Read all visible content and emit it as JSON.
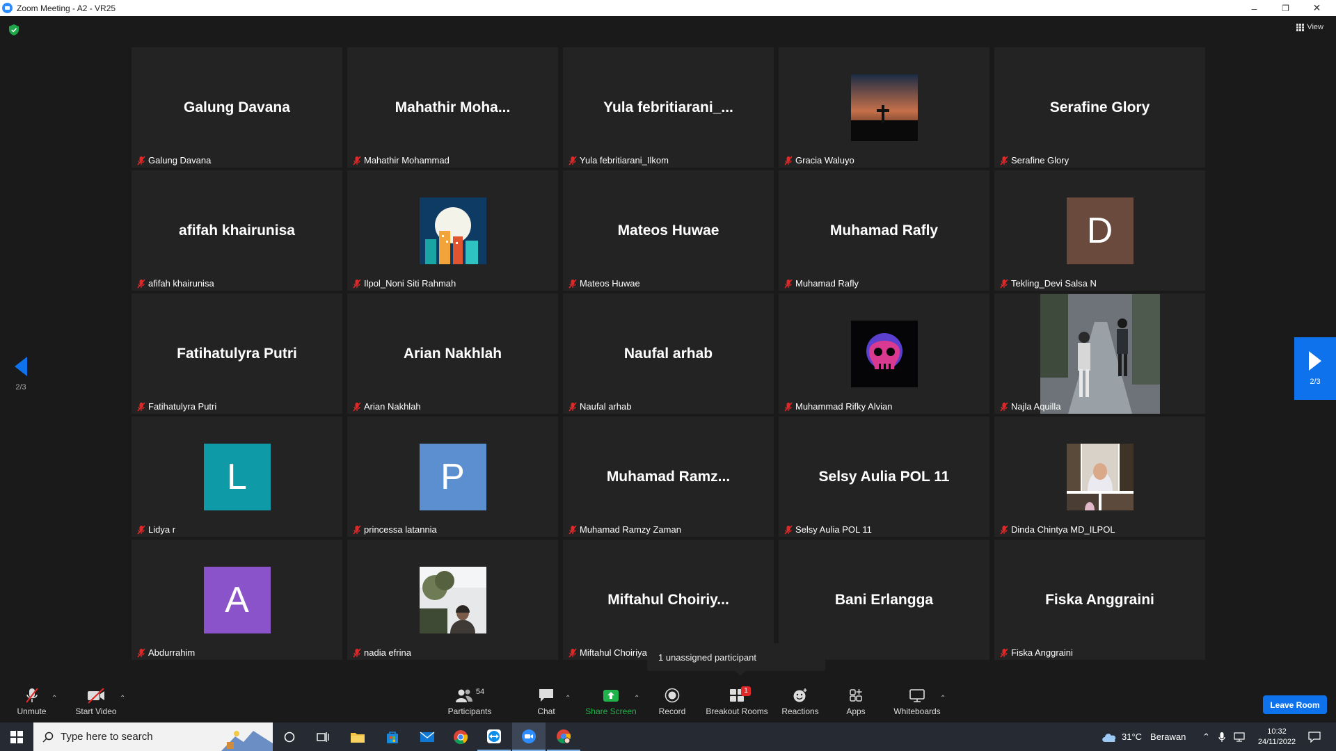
{
  "window": {
    "title": "Zoom Meeting - A2 - VR25",
    "minimize": "–",
    "restore": "❐",
    "close": "✕"
  },
  "view_button": {
    "label": "View"
  },
  "pagination": {
    "left": "2/3",
    "right": "2/3"
  },
  "participants": [
    {
      "display": "Galung Davana",
      "label": "Galung Davana",
      "kind": "name"
    },
    {
      "display": "Mahathir  Moha...",
      "label": "Mahathir Mohammad",
      "kind": "name"
    },
    {
      "display": "Yula  febritiarani_...",
      "label": "Yula febritiarani_Ilkom",
      "kind": "name"
    },
    {
      "display": "",
      "label": "Gracia Waluyo",
      "kind": "photo",
      "photo": "sunset-cross"
    },
    {
      "display": "Serafine Glory",
      "label": "Serafine Glory",
      "kind": "name"
    },
    {
      "display": "afifah khairunisa",
      "label": "afifah khairunisa",
      "kind": "name"
    },
    {
      "display": "",
      "label": "Ilpol_Noni Siti Rahmah",
      "kind": "photo",
      "photo": "moon-city"
    },
    {
      "display": "Mateos Huwae",
      "label": "Mateos Huwae",
      "kind": "name"
    },
    {
      "display": "Muhamad Rafly",
      "label": "Muhamad Rafly",
      "kind": "name"
    },
    {
      "display": "D",
      "label": "Tekling_Devi Salsa N",
      "kind": "letter",
      "color": "#6a4a3c"
    },
    {
      "display": "Fatihatulyra Putri",
      "label": "Fatihatulyra Putri",
      "kind": "name"
    },
    {
      "display": "Arian Nakhlah",
      "label": "Arian Nakhlah",
      "kind": "name"
    },
    {
      "display": "Naufal arhab",
      "label": "Naufal arhab",
      "kind": "name"
    },
    {
      "display": "",
      "label": "Muhammad Rifky Alvian",
      "kind": "photo",
      "photo": "neon-skull"
    },
    {
      "display": "",
      "label": "Najla Aquilla",
      "kind": "photo",
      "photo": "rainy-street"
    },
    {
      "display": "L",
      "label": "Lidya r",
      "kind": "letter",
      "color": "#0e9aa7"
    },
    {
      "display": "P",
      "label": "princessa latannia",
      "kind": "letter",
      "color": "#5b8fcf"
    },
    {
      "display": "Muhamad  Ramz...",
      "label": "Muhamad Ramzy Zaman",
      "kind": "name"
    },
    {
      "display": "Selsy Aulia POL 11",
      "label": "Selsy Aulia POL 11",
      "kind": "name"
    },
    {
      "display": "",
      "label": "Dinda Chintya MD_ILPOL",
      "kind": "photo",
      "photo": "hijab-collage"
    },
    {
      "display": "A",
      "label": "Abdurrahim",
      "kind": "letter",
      "color": "#8b53c9"
    },
    {
      "display": "",
      "label": "nadia efrina",
      "kind": "photo",
      "photo": "plant-person"
    },
    {
      "display": "Miftahul  Choiriy...",
      "label": "Miftahul Choiriyal",
      "kind": "name"
    },
    {
      "display": "Bani Erlangga",
      "label": "angga",
      "kind": "name"
    },
    {
      "display": "Fiska Anggraini",
      "label": "Fiska Anggraini",
      "kind": "name"
    }
  ],
  "tooltip": {
    "text": "1 unassigned participant"
  },
  "toolbar": {
    "unmute": "Unmute",
    "start_video": "Start Video",
    "participants": "Participants",
    "participants_count": "54",
    "chat": "Chat",
    "share_screen": "Share Screen",
    "record": "Record",
    "breakout_rooms": "Breakout Rooms",
    "breakout_badge": "1",
    "reactions": "Reactions",
    "apps": "Apps",
    "whiteboards": "Whiteboards",
    "leave_room": "Leave Room",
    "accent": "#0e72ed",
    "share_green": "#21b34b"
  },
  "taskbar": {
    "search_placeholder": "Type here to search",
    "weather_temp": "31°C",
    "weather_desc": "Berawan",
    "time": "10:32",
    "date": "24/11/2022"
  }
}
